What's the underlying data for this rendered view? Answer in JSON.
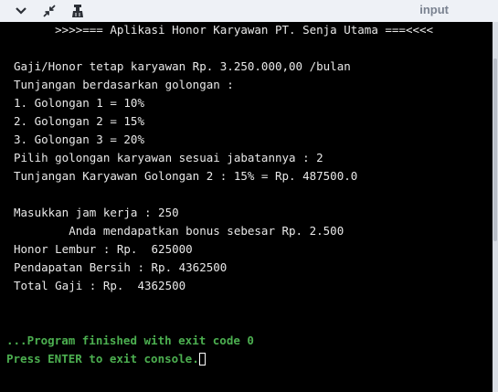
{
  "toolbar": {
    "icons": [
      "chevron-down-icon",
      "collapse-icon",
      "clear-icon"
    ],
    "input_label": "input"
  },
  "console": {
    "lines": [
      "      >>>>=== Aplikasi Honor Karyawan PT. Senja Utama ===<<<<",
      "Gaji/Honor tetap karyawan Rp. 3.250.000,00 /bulan",
      "Tunjangan berdasarkan golongan :",
      "1. Golongan 1 = 10%",
      "2. Golongan 2 = 15%",
      "3. Golongan 3 = 20%",
      "Pilih golongan karyawan sesuai jabatannya : 2",
      "Tunjangan Karyawan Golongan 2 : 15% = Rp. 487500.0",
      "Masukkan jam kerja : 250",
      "        Anda mendapatkan bonus sebesar Rp. 2.500",
      "Honor Lembur : Rp.  625000",
      "Pendapatan Bersih : Rp. 4362500",
      "Total Gaji : Rp.  4362500"
    ],
    "finish_lines": [
      "...Program finished with exit code 0",
      "Press ENTER to exit console."
    ]
  },
  "colors": {
    "console_bg": "#000000",
    "console_text": "#e8e8e8",
    "finish_text": "#4caf50",
    "toolbar_bg": "#eef1f6"
  }
}
